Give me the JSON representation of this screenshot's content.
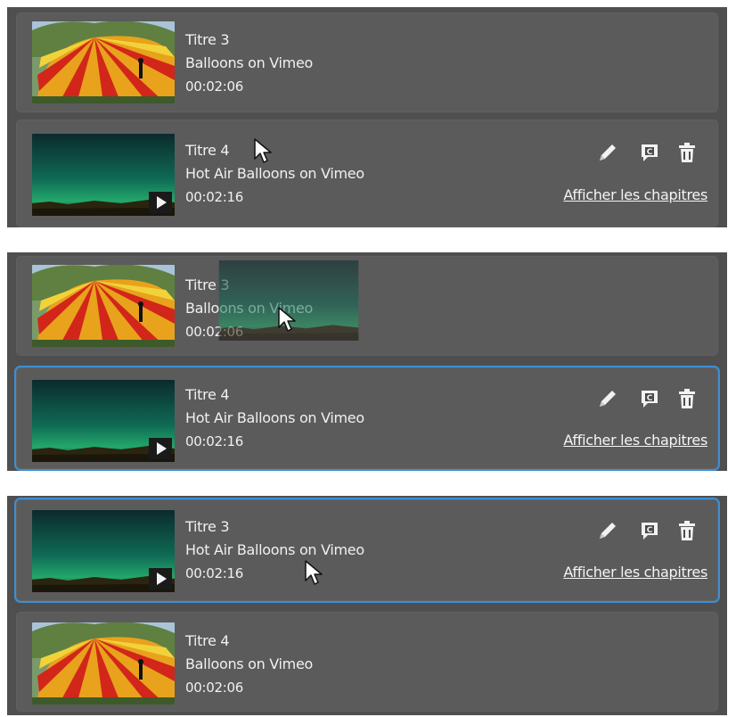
{
  "panels": [
    {
      "items": [
        {
          "title": "Titre 3",
          "name": "Balloons on Vimeo",
          "duration": "00:02:06",
          "thumb": "balloon",
          "play": false,
          "selected": false,
          "tools": false
        },
        {
          "title": "Titre 4",
          "name": "Hot Air Balloons on Vimeo",
          "duration": "00:02:16",
          "thumb": "sunset",
          "play": true,
          "selected": false,
          "tools": true,
          "chapters": "Afficher les chapitres"
        }
      ]
    },
    {
      "items": [
        {
          "title": "Titre 3",
          "name": "Balloons on Vimeo",
          "duration": "00:02:06",
          "thumb": "balloon",
          "play": false,
          "selected": false,
          "tools": false
        },
        {
          "title": "Titre 4",
          "name": "Hot Air Balloons on Vimeo",
          "duration": "00:02:16",
          "thumb": "sunset",
          "play": true,
          "selected": true,
          "tools": true,
          "chapters": "Afficher les chapitres"
        }
      ]
    },
    {
      "items": [
        {
          "title": "Titre 3",
          "name": "Hot Air Balloons on Vimeo",
          "duration": "00:02:16",
          "thumb": "sunset",
          "play": true,
          "selected": true,
          "tools": true,
          "chapters": "Afficher les chapitres"
        },
        {
          "title": "Titre 4",
          "name": "Balloons on Vimeo",
          "duration": "00:02:06",
          "thumb": "balloon",
          "play": false,
          "selected": false,
          "tools": false
        }
      ]
    }
  ],
  "icons": {
    "edit": "pencil-icon",
    "chapters": "chapter-c-icon",
    "delete": "trash-icon",
    "play": "play-icon",
    "cursor": "mouse-pointer-icon"
  },
  "colors": {
    "panel_bg": "#4f4f4f",
    "item_bg": "#5b5b5b",
    "selected_border": "#3b8fd6",
    "text": "#f0f0f0"
  }
}
